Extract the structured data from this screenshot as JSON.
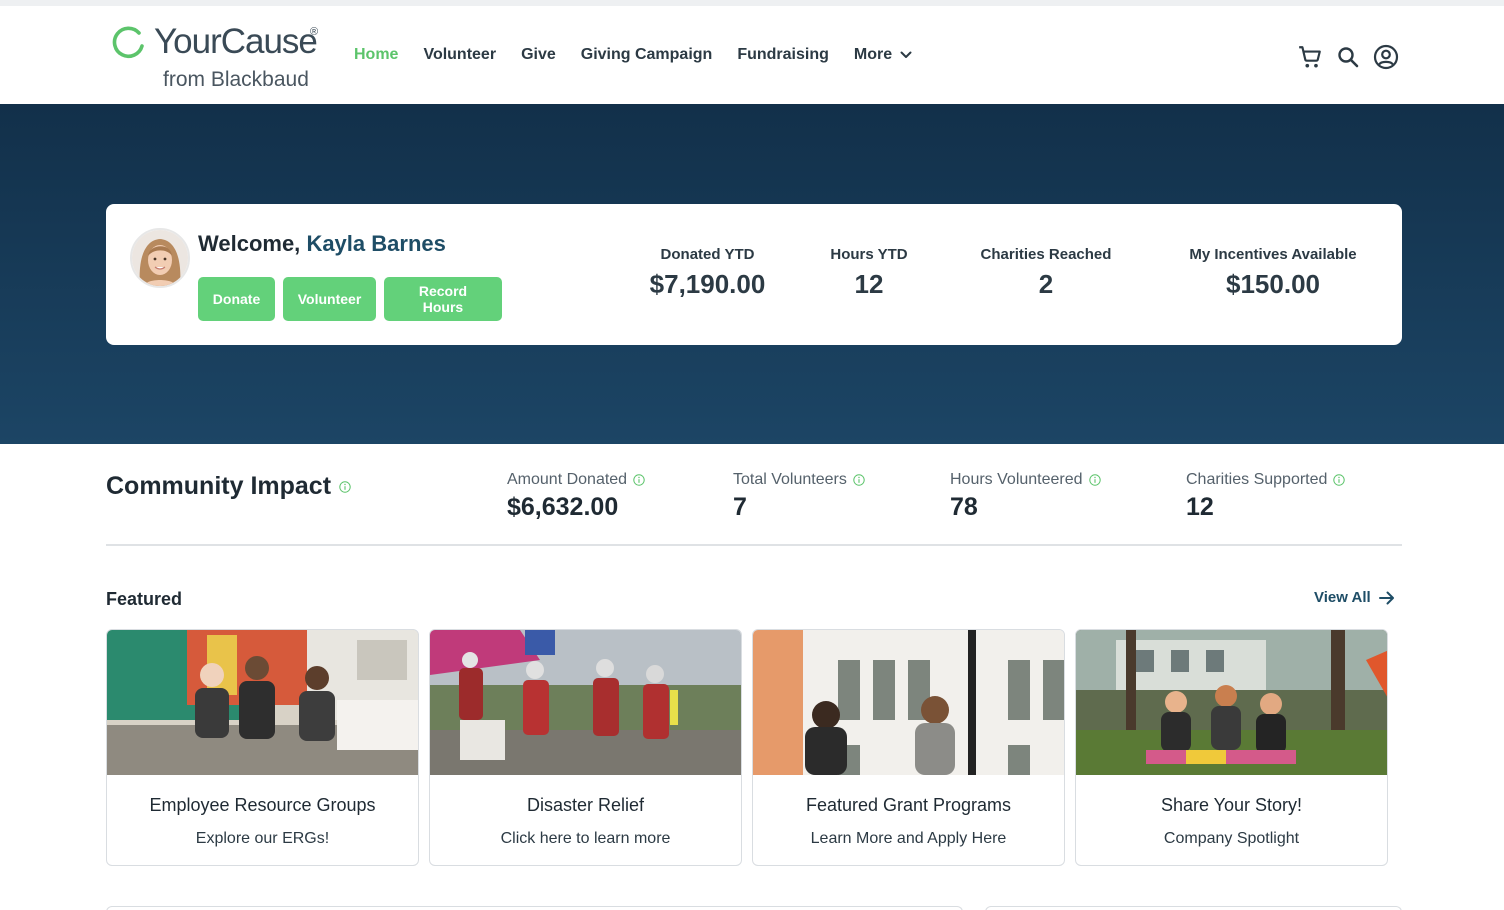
{
  "brand": {
    "name": "YourCause",
    "registered": "®",
    "tagline": "from Blackbaud"
  },
  "nav": {
    "items": [
      "Home",
      "Volunteer",
      "Give",
      "Giving Campaign",
      "Fundraising"
    ],
    "more_label": "More",
    "active": "Home"
  },
  "header_icons": [
    "cart-icon",
    "search-icon",
    "account-icon"
  ],
  "welcome": {
    "greeting": "Welcome,",
    "name": "Kayla Barnes",
    "buttons": {
      "donate": "Donate",
      "volunteer": "Volunteer",
      "record_hours": "Record Hours"
    }
  },
  "ytd_stats": [
    {
      "label": "Donated YTD",
      "value": "$7,190.00"
    },
    {
      "label": "Hours YTD",
      "value": "12"
    },
    {
      "label": "Charities Reached",
      "value": "2"
    },
    {
      "label": "My Incentives Available",
      "value": "$150.00"
    }
  ],
  "community_impact": {
    "title": "Community Impact",
    "stats": [
      {
        "label": "Amount Donated",
        "value": "$6,632.00"
      },
      {
        "label": "Total Volunteers",
        "value": "7"
      },
      {
        "label": "Hours Volunteered",
        "value": "78"
      },
      {
        "label": "Charities Supported",
        "value": "12"
      }
    ]
  },
  "featured": {
    "title": "Featured",
    "view_all": "View All",
    "cards": [
      {
        "title": "Employee Resource Groups",
        "subtitle": "Explore our ERGs!"
      },
      {
        "title": "Disaster Relief",
        "subtitle": "Click here to learn more"
      },
      {
        "title": "Featured Grant Programs",
        "subtitle": "Learn More and Apply Here"
      },
      {
        "title": "Share Your Story!",
        "subtitle": "Company Spotlight"
      }
    ]
  },
  "colors": {
    "accent_green": "#63d17a",
    "nav_active": "#5cc46b",
    "hero_navy": "#16385a",
    "name_teal": "#1e4d66"
  }
}
